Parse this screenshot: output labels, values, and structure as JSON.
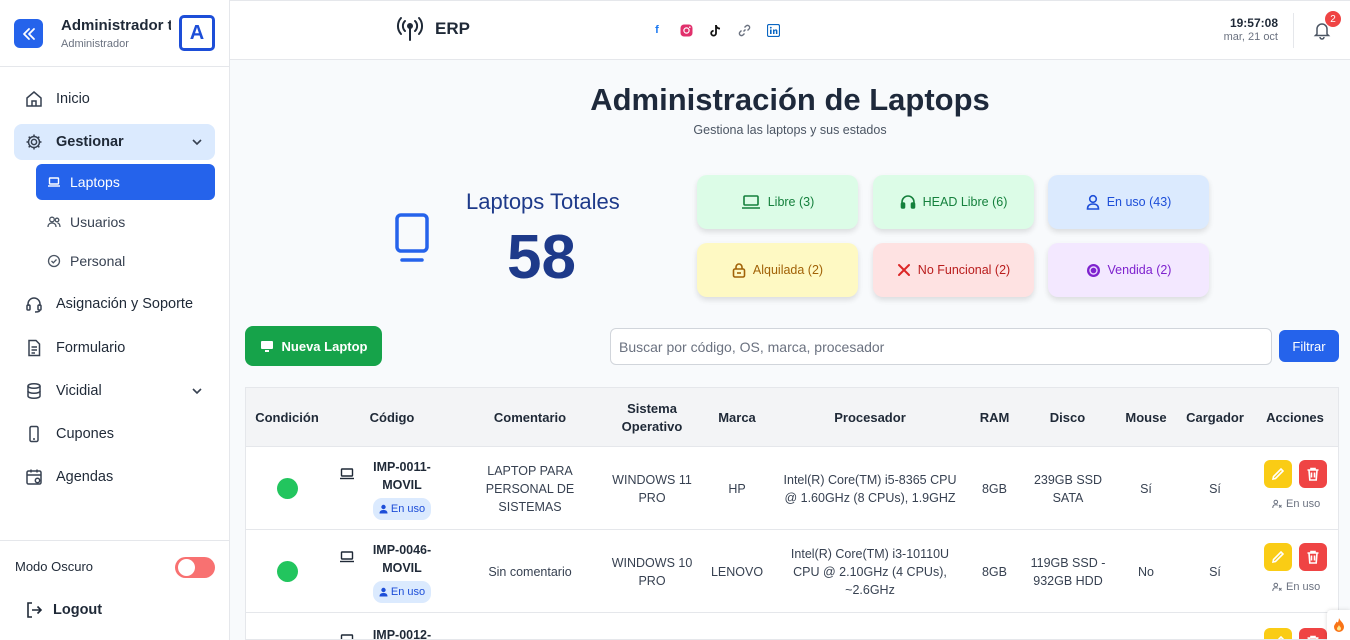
{
  "sidebar": {
    "user": {
      "name": "Administrador ti",
      "role": "Administrador",
      "avatar_letter": "A"
    },
    "items": [
      {
        "label": "Inicio",
        "icon": "home-icon"
      },
      {
        "label": "Gestionar",
        "icon": "gear-icon"
      },
      {
        "label": "Asignación y Soporte",
        "icon": "headset-icon"
      },
      {
        "label": "Formulario",
        "icon": "document-icon"
      },
      {
        "label": "Vicidial",
        "icon": "database-icon"
      },
      {
        "label": "Cupones",
        "icon": "mobile-icon"
      },
      {
        "label": "Agendas",
        "icon": "calendar-icon"
      }
    ],
    "subitems": [
      {
        "label": "Laptops",
        "icon": "laptop-icon",
        "active": true
      },
      {
        "label": "Usuarios",
        "icon": "users-icon"
      },
      {
        "label": "Personal",
        "icon": "check-circle-icon"
      }
    ],
    "dark_mode_label": "Modo Oscuro",
    "logout_label": "Logout"
  },
  "topbar": {
    "brand": "ERP",
    "socials": [
      "facebook-icon",
      "instagram-icon",
      "tiktok-icon",
      "link-icon",
      "linkedin-icon"
    ],
    "time": "19:57:08",
    "date": "mar, 21 oct",
    "notifications": "2"
  },
  "main": {
    "title": "Administración de Laptops",
    "subtitle": "Gestiona las laptops y sus estados",
    "total_label": "Laptops Totales",
    "total_value": "58",
    "stats": [
      {
        "label": "Libre (3)",
        "icon": "laptop-icon",
        "bg": "#dcfce7",
        "fg": "#15803d"
      },
      {
        "label": "HEAD Libre (6)",
        "icon": "headphones-icon",
        "bg": "#dcfce7",
        "fg": "#15803d"
      },
      {
        "label": "En uso (43)",
        "icon": "user-icon",
        "bg": "#dbeafe",
        "fg": "#1d4ed8"
      },
      {
        "label": "Alquilada (2)",
        "icon": "lock-icon",
        "bg": "#fef9c3",
        "fg": "#a16207"
      },
      {
        "label": "No Funcional (2)",
        "icon": "wrench-cross-icon",
        "bg": "#fee2e2",
        "fg": "#b91c1c"
      },
      {
        "label": "Vendida (2)",
        "icon": "coin-icon",
        "bg": "#f3e8ff",
        "fg": "#7e22ce"
      }
    ],
    "new_button": "Nueva Laptop",
    "search_placeholder": "Buscar por código, OS, marca, procesador",
    "filter_button": "Filtrar"
  },
  "table": {
    "headers": [
      "Condición",
      "Código",
      "Comentario",
      "Sistema Operativo",
      "Marca",
      "Procesador",
      "RAM",
      "Disco",
      "Mouse",
      "Cargador",
      "Acciones"
    ],
    "rows": [
      {
        "condition_color": "#22c55e",
        "code": "IMP-0011-MOVIL",
        "status": "En uso",
        "comment": "LAPTOP PARA PERSONAL DE SISTEMAS",
        "os": "WINDOWS 11 PRO",
        "brand": "HP",
        "cpu": "Intel(R) Core(TM) i5-8365 CPU @ 1.60GHz (8 CPUs), 1.9GHZ",
        "ram": "8GB",
        "disk": "239GB SSD SATA",
        "mouse": "Sí",
        "charger": "Sí",
        "action_note": "En uso"
      },
      {
        "condition_color": "#22c55e",
        "code": "IMP-0046-MOVIL",
        "status": "En uso",
        "comment": "Sin comentario",
        "os": "WINDOWS 10 PRO",
        "brand": "LENOVO",
        "cpu": "Intel(R) Core(TM) i3-10110U CPU @ 2.10GHz (4 CPUs), ~2.6GHz",
        "ram": "8GB",
        "disk": "119GB SSD - 932GB HDD",
        "mouse": "No",
        "charger": "Sí",
        "action_note": "En uso"
      },
      {
        "code": "IMP-0012-"
      }
    ]
  }
}
